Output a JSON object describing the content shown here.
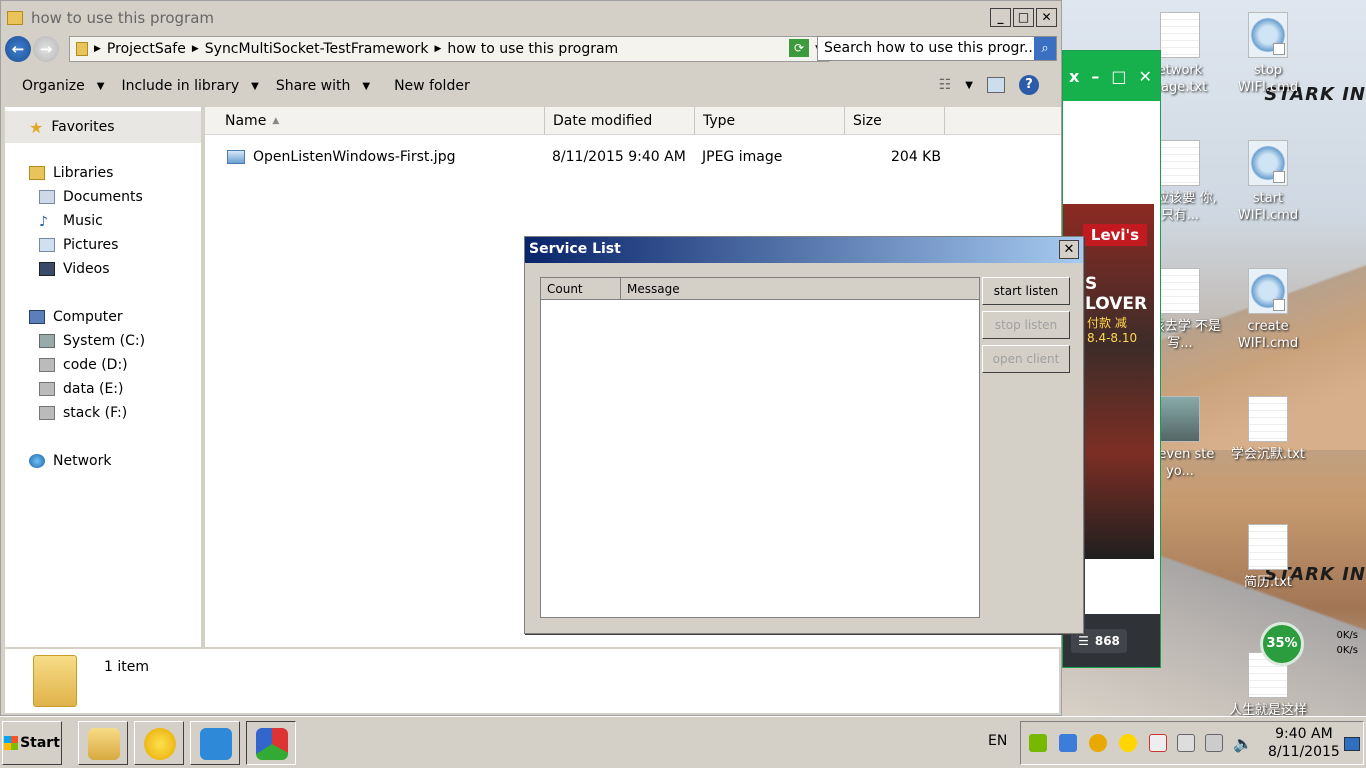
{
  "explorer": {
    "title": "how to use this program",
    "breadcrumb": [
      "ProjectSafe",
      "SyncMultiSocket-TestFramework",
      "how to use this program"
    ],
    "search_placeholder": "Search how to use this progr...",
    "toolbar": {
      "organize": "Organize",
      "include_in_library": "Include in library",
      "share_with": "Share with",
      "new_folder": "New folder"
    },
    "nav": {
      "favorites": "Favorites",
      "libraries": "Libraries",
      "library_items": [
        "Documents",
        "Music",
        "Pictures",
        "Videos"
      ],
      "computer": "Computer",
      "drives": [
        "System (C:)",
        "code (D:)",
        "data (E:)",
        "stack (F:)"
      ],
      "network": "Network"
    },
    "columns": {
      "name": "Name",
      "date_modified": "Date modified",
      "type": "Type",
      "size": "Size"
    },
    "files": [
      {
        "name": "OpenListenWindows-First.jpg",
        "date": "8/11/2015 9:40 AM",
        "type": "JPEG image",
        "size": "204 KB"
      }
    ],
    "status": "1 item"
  },
  "dialog": {
    "title": "Service List",
    "columns": {
      "count": "Count",
      "message": "Message"
    },
    "buttons": {
      "start_listen": "start listen",
      "stop_listen": "stop listen",
      "open_client": "open client"
    }
  },
  "green_window": {
    "ad_brand": "Levi's",
    "ad_headline": "S LOVER",
    "ad_sub": "付款 减",
    "ad_date": "8.4-8.10",
    "count_badge": "868"
  },
  "desktop": {
    "brand_text": "STARK IN",
    "icons_right": [
      {
        "label": "stop WIFI.cmd",
        "kind": "gear"
      },
      {
        "label": "start WIFI.cmd",
        "kind": "gear"
      },
      {
        "label": "create WIFI.cmd",
        "kind": "gear"
      },
      {
        "label": "学会沉默.txt",
        "kind": "txt"
      },
      {
        "label": "简历.txt",
        "kind": "txt"
      },
      {
        "label": "人生就是这样",
        "kind": "txt"
      }
    ],
    "icons_left": [
      {
        "label": "etwork nage.txt"
      },
      {
        "label": "人应该要 你,只有..."
      },
      {
        "label": "就该去学 不是写..."
      },
      {
        "label": "'t even ste yo..."
      }
    ]
  },
  "speed_widget": {
    "percent": "35%",
    "up": "0K/s",
    "down": "0K/s"
  },
  "taskbar": {
    "start": "Start",
    "lang": "EN",
    "time": "9:40 AM",
    "date": "8/11/2015"
  }
}
